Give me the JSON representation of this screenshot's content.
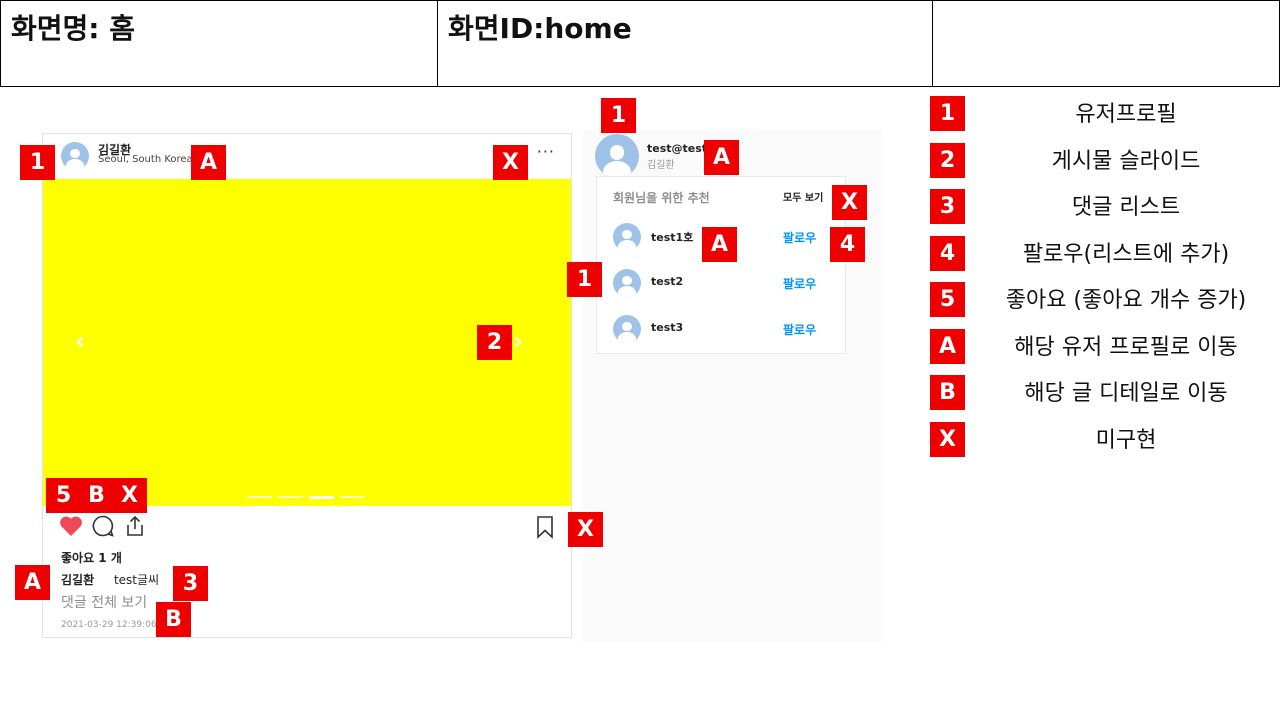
{
  "header": {
    "screen_name": "화면명: 홈",
    "screen_id": "화면ID:home",
    "extra": ""
  },
  "post": {
    "username": "김길환",
    "location": "Seoul, South Korea",
    "more_label": "···",
    "prev_label": "‹",
    "next_label": "›",
    "likes_text": "좋아요 1 개",
    "comment_user": "김길환",
    "comment_text": "test글씨",
    "view_all_comments": "댓글 전체 보기",
    "timestamp": "2021-03-29 12:39:06.0",
    "media_color": "#ffff00",
    "slide_count": 4,
    "active_slide": 3
  },
  "panel": {
    "my_id": "test@test",
    "my_name": "김길환",
    "recommend_title": "회원님을 위한 추천",
    "see_all": "모두 보기",
    "recommendations": [
      {
        "name": "test1호",
        "follow": "팔로우"
      },
      {
        "name": "test2",
        "follow": "팔로우"
      },
      {
        "name": "test3",
        "follow": "팔로우"
      }
    ]
  },
  "annotations": {
    "post_profile_num": "1",
    "post_profile_link": "A",
    "post_more_x": "X",
    "slide_num": "2",
    "like_num": "5",
    "detail_b": "B",
    "share_x": "X",
    "bookmark_x": "X",
    "comment_user_a": "A",
    "comment_num": "3",
    "view_all_b": "B",
    "panel_profile_num": "1",
    "panel_profile_a": "A",
    "see_all_x": "X",
    "rec_name_a": "A",
    "follow_num": "4",
    "rec_list_num": "1"
  },
  "legend": [
    {
      "badge": "1",
      "text": "유저프로필"
    },
    {
      "badge": "2",
      "text": "게시물 슬라이드"
    },
    {
      "badge": "3",
      "text": "댓글 리스트"
    },
    {
      "badge": "4",
      "text": "팔로우(리스트에 추가)"
    },
    {
      "badge": "5",
      "text": "좋아요 (좋아요 개수 증가)"
    },
    {
      "badge": "A",
      "text": "해당 유저 프로필로 이동"
    },
    {
      "badge": "B",
      "text": "해당 글 디테일로 이동"
    },
    {
      "badge": "X",
      "text": "미구현"
    }
  ],
  "colors": {
    "badge": "#ee0000",
    "heart": "#ed4956",
    "follow": "#0095f6",
    "avatar": "#9fc3e8"
  }
}
